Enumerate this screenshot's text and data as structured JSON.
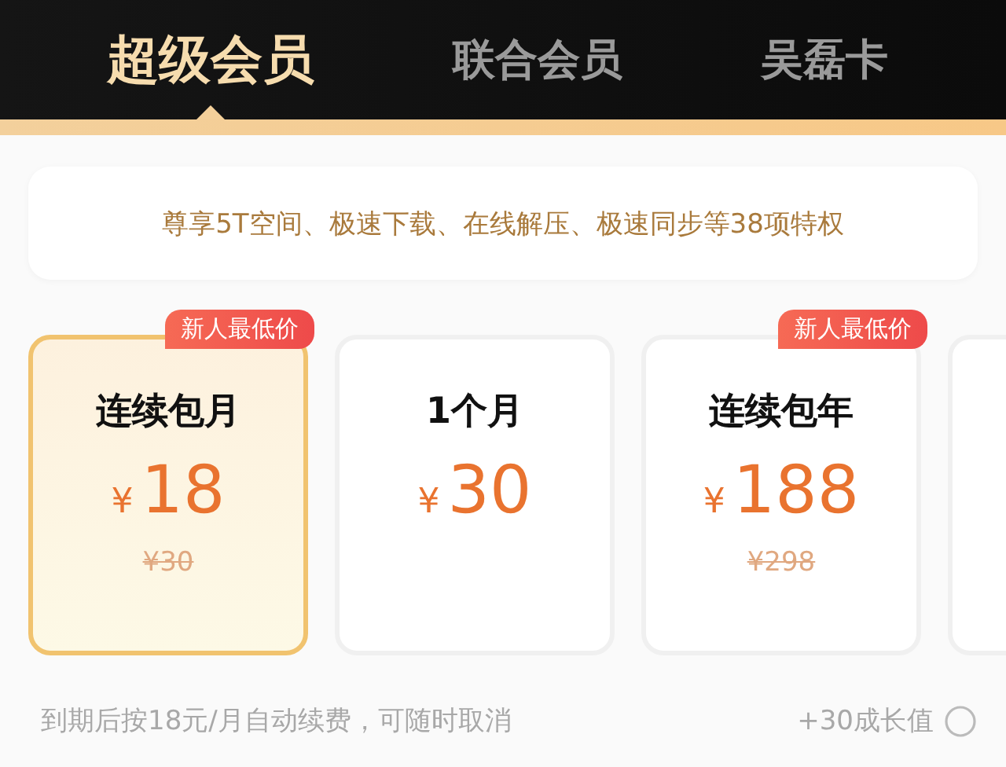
{
  "tabs": [
    {
      "label": "超级会员",
      "selected": true
    },
    {
      "label": "联合会员",
      "selected": false
    },
    {
      "label": "吴磊卡",
      "selected": false
    }
  ],
  "banner": "尊享5T空间、极速下载、在线解压、极速同步等38项特权",
  "plans": [
    {
      "kind": "plan",
      "name": "连续包月",
      "currency": "¥",
      "price": "18",
      "original_price": "¥30",
      "badge": "新人最低价",
      "selected": true
    },
    {
      "kind": "plan",
      "name": "1个月",
      "currency": "¥",
      "price": "30",
      "selected": false
    },
    {
      "kind": "plan",
      "name": "连续包年",
      "currency": "¥",
      "price": "188",
      "original_price": "¥298",
      "badge": "新人最低价",
      "selected": false
    },
    {
      "kind": "partial",
      "selected": false
    }
  ],
  "footer": {
    "note": "到期后按18元/月自动续费，可随时取消",
    "bonus": "+30成长值"
  }
}
